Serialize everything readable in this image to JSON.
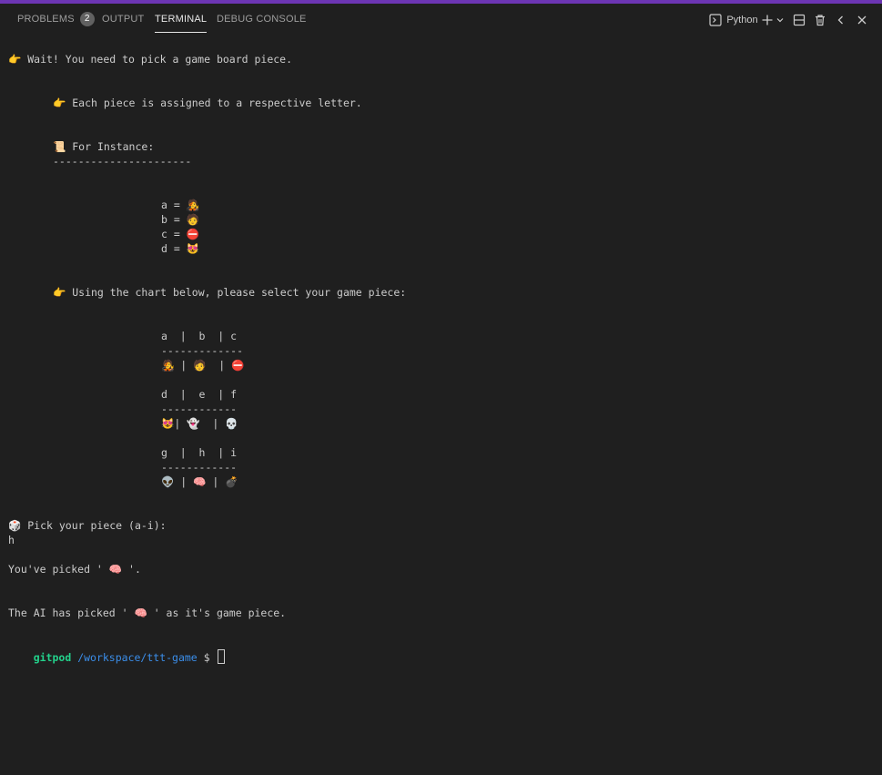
{
  "tabs": {
    "problems": "PROBLEMS",
    "problems_count": "2",
    "output": "OUTPUT",
    "terminal": "TERMINAL",
    "debug_console": "DEBUG CONSOLE"
  },
  "toolbar": {
    "shell_label": "Python",
    "icons": [
      "terminal-icon",
      "plus-icon",
      "chevron-down-icon",
      "split-icon",
      "trash-icon",
      "chevron-left-icon",
      "close-icon"
    ]
  },
  "terminal": {
    "lines": [
      "👉 Wait! You need to pick a game board piece.",
      "👉 Each piece is assigned to a respective letter.",
      "📜 For Instance:",
      "----------------------",
      "a = 🧑‍🎤",
      "b = 🧑",
      "c = ⛔",
      "d = 😻",
      "👉 Using the chart below, please select your game piece:",
      "a  |  b  | c",
      "-------------",
      "🧑‍🎤 | 🧑  | ⛔",
      "d  |  e  | f",
      "------------",
      "😻| 👻  | 💀",
      "g  |  h  | i",
      "------------",
      "👽 | 🧠 | 💣",
      "🎲 Pick your piece (a-i):",
      "h",
      "You've picked ' 🧠 '.",
      "The AI has picked ' 🧠 ' as it's game piece."
    ],
    "prompt_user": "gitpod",
    "prompt_path": "/workspace/ttt-game",
    "prompt_symbol": "$"
  },
  "colors": {
    "background": "#1f1f1f",
    "accent": "#6c35b3",
    "prompt_user": "#23d18b",
    "prompt_path": "#3b8eea"
  }
}
